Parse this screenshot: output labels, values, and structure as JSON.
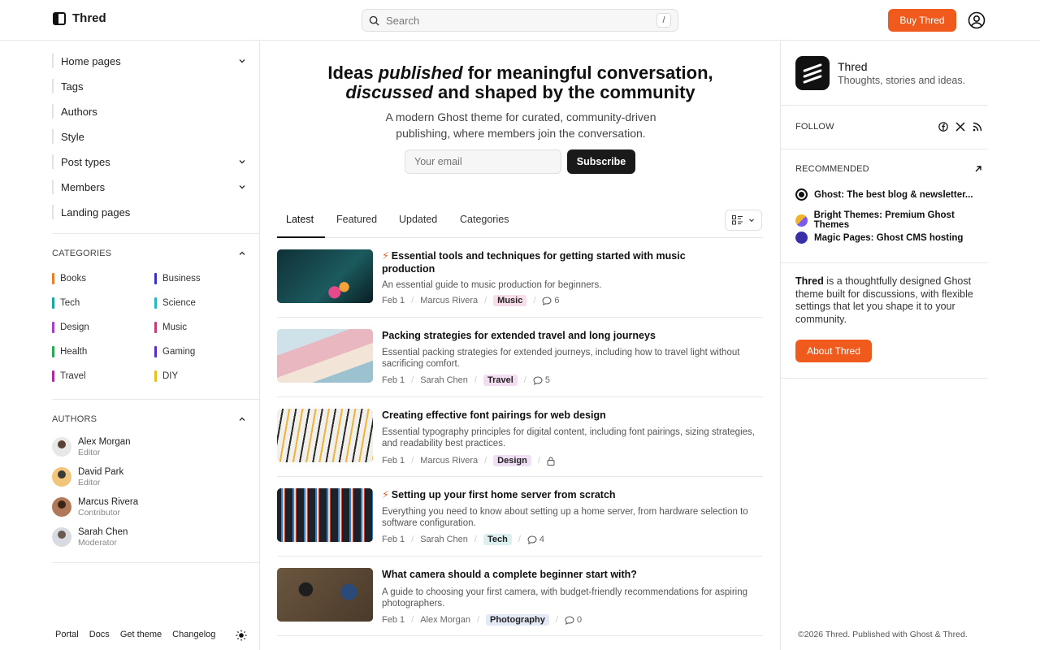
{
  "header": {
    "logo_text": "Thred",
    "search_placeholder": "Search",
    "search_shortcut": "/",
    "buy_button": "Buy Thred"
  },
  "sidebar": {
    "nav": [
      {
        "label": "Home pages",
        "expandable": true
      },
      {
        "label": "Tags",
        "expandable": false
      },
      {
        "label": "Authors",
        "expandable": false
      },
      {
        "label": "Style",
        "expandable": false
      },
      {
        "label": "Post types",
        "expandable": true
      },
      {
        "label": "Members",
        "expandable": true
      },
      {
        "label": "Landing pages",
        "expandable": false
      }
    ],
    "categories_title": "CATEGORIES",
    "categories": [
      {
        "label": "Books",
        "color": "#f07a2a"
      },
      {
        "label": "Business",
        "color": "#3b2fc9"
      },
      {
        "label": "Tech",
        "color": "#1aa7a0"
      },
      {
        "label": "Science",
        "color": "#26b6c4"
      },
      {
        "label": "Design",
        "color": "#a53ec9"
      },
      {
        "label": "Music",
        "color": "#c73b79"
      },
      {
        "label": "Health",
        "color": "#2aa84f"
      },
      {
        "label": "Gaming",
        "color": "#5b2bc9"
      },
      {
        "label": "Travel",
        "color": "#b02aa6"
      },
      {
        "label": "DIY",
        "color": "#e8c21c"
      }
    ],
    "authors_title": "AUTHORS",
    "authors": [
      {
        "name": "Alex Morgan",
        "role": "Editor"
      },
      {
        "name": "David Park",
        "role": "Editor"
      },
      {
        "name": "Marcus Rivera",
        "role": "Contributor"
      },
      {
        "name": "Sarah Chen",
        "role": "Moderator"
      }
    ],
    "footer_links": [
      "Portal",
      "Docs",
      "Get theme",
      "Changelog"
    ]
  },
  "hero": {
    "title_1a": "Ideas ",
    "title_1b": "published",
    "title_1c": " for meaningful conversation,",
    "title_2a": "discussed",
    "title_2b": " and shaped by the community",
    "subtitle": "A modern Ghost theme for curated, community-driven publishing, where members join the conversation.",
    "email_placeholder": "Your email",
    "subscribe_button": "Subscribe"
  },
  "tabs": [
    "Latest",
    "Featured",
    "Updated",
    "Categories"
  ],
  "posts": [
    {
      "title": "Essential tools and techniques for getting started with music production",
      "featured": true,
      "excerpt": "An essential guide to music production for beginners.",
      "date": "Feb 1",
      "author": "Marcus Rivera",
      "tag": "Music",
      "tag_color": "#f6dde9",
      "comments": "6",
      "locked": false
    },
    {
      "title": "Packing strategies for extended travel and long journeys",
      "featured": false,
      "excerpt": "Essential packing strategies for extended journeys, including how to travel light without sacrificing comfort.",
      "date": "Feb 1",
      "author": "Sarah Chen",
      "tag": "Travel",
      "tag_color": "#f3ddf1",
      "comments": "5",
      "locked": false
    },
    {
      "title": "Creating effective font pairings for web design",
      "featured": false,
      "excerpt": "Essential typography principles for digital content, including font pairings, sizing strategies, and readability best practices.",
      "date": "Feb 1",
      "author": "Marcus Rivera",
      "tag": "Design",
      "tag_color": "#efe0f6",
      "comments": "",
      "locked": true
    },
    {
      "title": "Setting up your first home server from scratch",
      "featured": true,
      "excerpt": "Everything you need to know about setting up a home server, from hardware selection to software configuration.",
      "date": "Feb 1",
      "author": "Sarah Chen",
      "tag": "Tech",
      "tag_color": "#dcf1ef",
      "comments": "4",
      "locked": false
    },
    {
      "title": "What camera should a complete beginner start with?",
      "featured": false,
      "excerpt": "A guide to choosing your first camera, with budget-friendly recommendations for aspiring photographers.",
      "date": "Feb 1",
      "author": "Alex Morgan",
      "tag": "Photography",
      "tag_color": "#e3e9f5",
      "comments": "0",
      "locked": false
    }
  ],
  "right": {
    "brand_name": "Thred",
    "brand_tagline": "Thoughts, stories and ideas.",
    "follow_title": "FOLLOW",
    "recommended_title": "RECOMMENDED",
    "recommended": [
      {
        "label": "Ghost: The best blog & newsletter...",
        "icon": "ghost-icon",
        "color": "#111111"
      },
      {
        "label": "Bright Themes: Premium Ghost Themes",
        "icon": "bright-themes-icon",
        "color": "#f0b429"
      },
      {
        "label": "Magic Pages: Ghost CMS hosting",
        "icon": "magic-pages-icon",
        "color": "#3b2fa8"
      }
    ],
    "about_bold": "Thred",
    "about_text": " is a thoughtfully designed Ghost theme built for discussions, with flexible settings that let you shape it to your community.",
    "about_button": "About Thred",
    "copyright": "©2026 Thred. Published with Ghost & Thred."
  },
  "colors": {
    "accent": "#f05a1d",
    "dark": "#1a1a1a"
  }
}
